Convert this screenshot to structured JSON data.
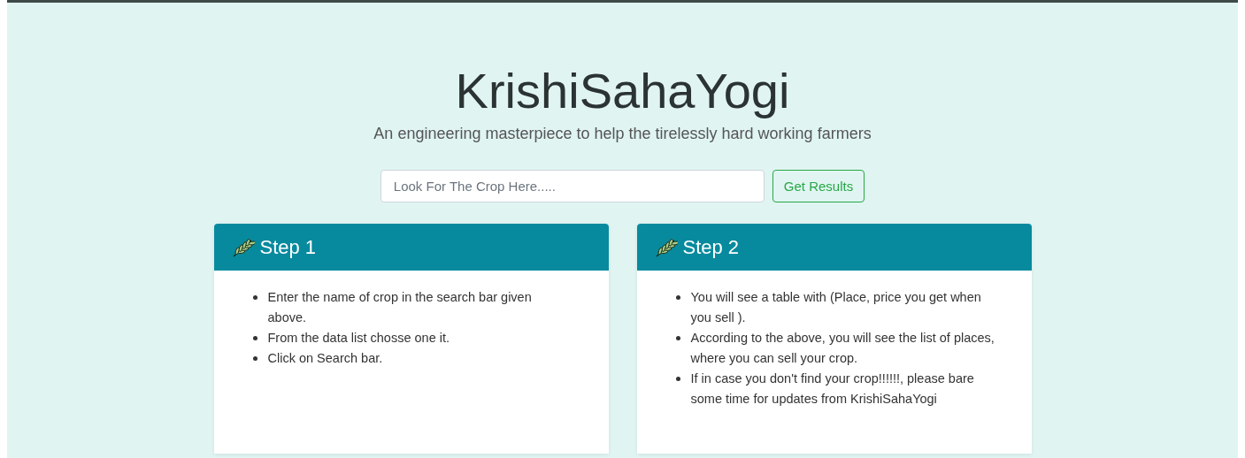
{
  "header": {
    "title": "KrishiSahaYogi",
    "subtitle": "An engineering masterpiece to help the tirelessly hard working farmers"
  },
  "search": {
    "placeholder": "Look For The Crop Here.....",
    "button": "Get Results"
  },
  "cards": [
    {
      "title": "Step 1",
      "items": [
        "Enter the name of crop in the search bar given above.",
        "From the data list chosse one it.",
        "Click on Search bar."
      ]
    },
    {
      "title": "Step 2",
      "items": [
        "You will see a table with (Place, price you get when you sell ).",
        "According to the above, you will see the list of places, where you can sell your crop.",
        "If in case you don't find your crop!!!!!!, please bare some time for updates from KrishiSahaYogi"
      ]
    }
  ]
}
